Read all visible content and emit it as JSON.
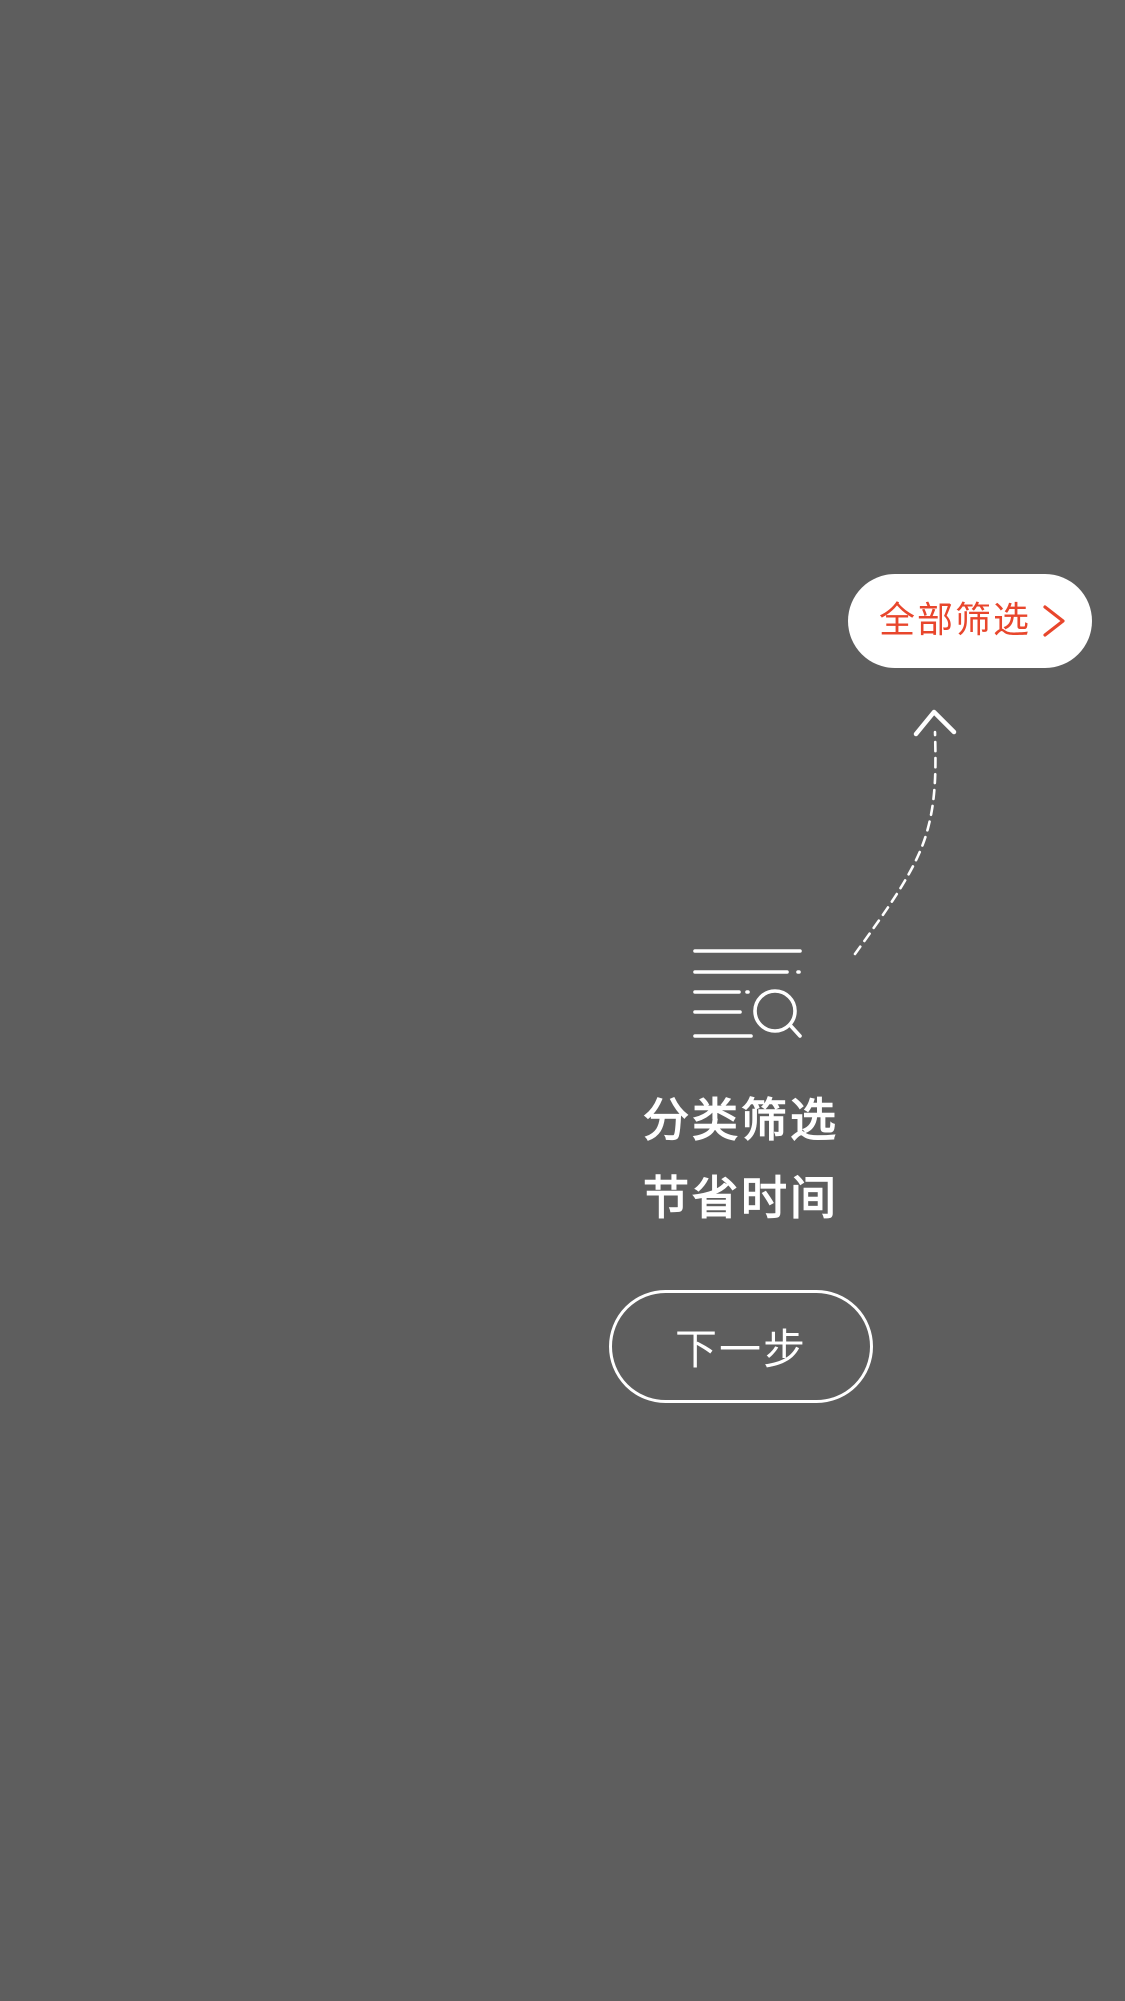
{
  "overlay": {
    "background_color": "#5e5e5e"
  },
  "filter_pill": {
    "label": "全部筛选",
    "icon": "chevron-right-icon",
    "accent_color": "#e8462c"
  },
  "guide": {
    "arrow_icon": "dashed-arrow-up-icon",
    "filter_icon": "list-search-icon",
    "line1": "分类筛选",
    "line2": "节省时间"
  },
  "next_button": {
    "label": "下一步"
  }
}
